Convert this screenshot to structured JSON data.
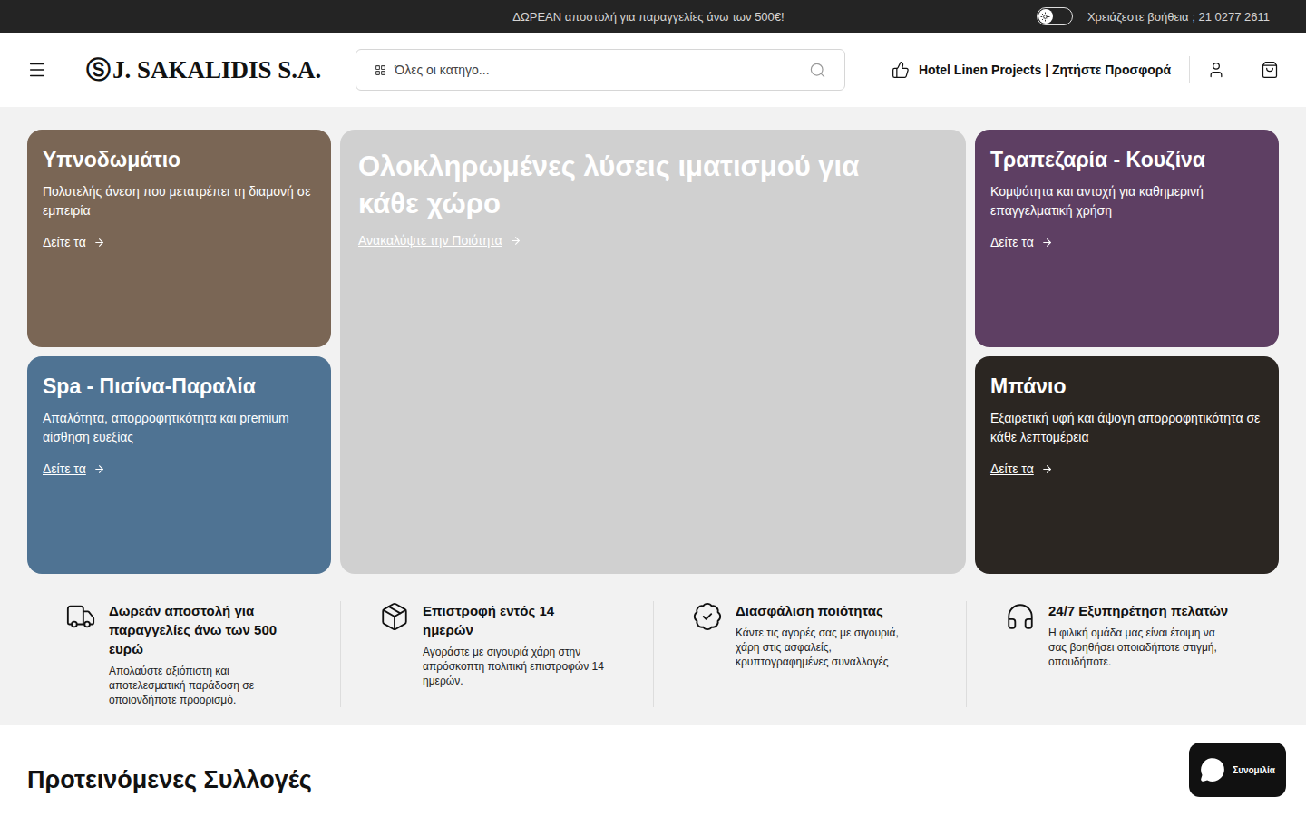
{
  "topbar": {
    "announcement": "ΔΩΡΕΑΝ αποστολή για παραγγελίες άνω των 500€!",
    "dark_mode": false,
    "help": "Χρειάζεστε βοήθεια ; 21 0277 2611"
  },
  "header": {
    "logo": {
      "mark": "Ⓢ",
      "text": "J. SAKALIDIS S.A."
    },
    "category": "Όλες οι κατηγο...",
    "search_placeholder": "",
    "cta": "Hotel Linen Projects | Ζητήστε Προσφορά"
  },
  "hero": {
    "tiles": [
      {
        "kind": "category",
        "title": "Υπνοδωμάτιο",
        "text": "Πολυτελής άνεση που μετατρέπει τη διαμονή σε εμπειρία",
        "link": "Δείτε τα",
        "color": "#7a6655"
      },
      {
        "kind": "banner",
        "title": "Ολοκληρωμένες λύσεις ιματισμού για κάθε χώρο",
        "text": "",
        "link": "Ανακαλύψτε την Ποιότητα",
        "color": "#d0d0d0"
      },
      {
        "kind": "category",
        "title": "Τραπεζαρία - Κουζίνα",
        "text": "Κομψότητα και αντοχή για καθημερινή επαγγελματική χρήση",
        "link": "Δείτε τα",
        "color": "#5e3f63"
      },
      {
        "kind": "category",
        "title": "Spa - Πισίνα-Παραλία",
        "text": "Απαλότητα, απορροφητικότητα και premium αίσθηση ευεξίας",
        "link": "Δείτε τα",
        "color": "#4f7393"
      },
      {
        "kind": "category",
        "title": "Μπάνιο",
        "text": "Εξαιρετική υφή και άψογη απορροφητικότητα σε κάθε λεπτομέρεια",
        "link": "Δείτε τα",
        "color": "#2b2622"
      }
    ]
  },
  "features": [
    {
      "icon": "truck",
      "title": "Δωρεάν αποστολή για παραγγελίες άνω των 500 ευρώ",
      "text": "Απολαύστε αξιόπιστη και αποτελεσματική παράδοση σε οποιονδήποτε προορισμό."
    },
    {
      "icon": "package",
      "title": "Επιστροφή εντός 14 ημερών",
      "text": "Αγοράστε με σιγουριά χάρη στην απρόσκοπτη πολιτική επιστροφών 14 ημερών."
    },
    {
      "icon": "badge",
      "title": "Διασφάλιση ποιότητας",
      "text": "Κάντε τις αγορές σας με σιγουριά, χάρη στις ασφαλείς, κρυπτογραφημένες συναλλαγές"
    },
    {
      "icon": "headphones",
      "title": "24/7 Εξυπηρέτηση πελατών",
      "text": "Η φιλική ομάδα μας είναι έτοιμη να σας βοηθήσει οποιαδήποτε στιγμή, οπουδήποτε."
    }
  ],
  "collections": {
    "title": "Προτεινόμενες Συλλογές"
  },
  "chat": {
    "label": "Συνομιλία"
  }
}
